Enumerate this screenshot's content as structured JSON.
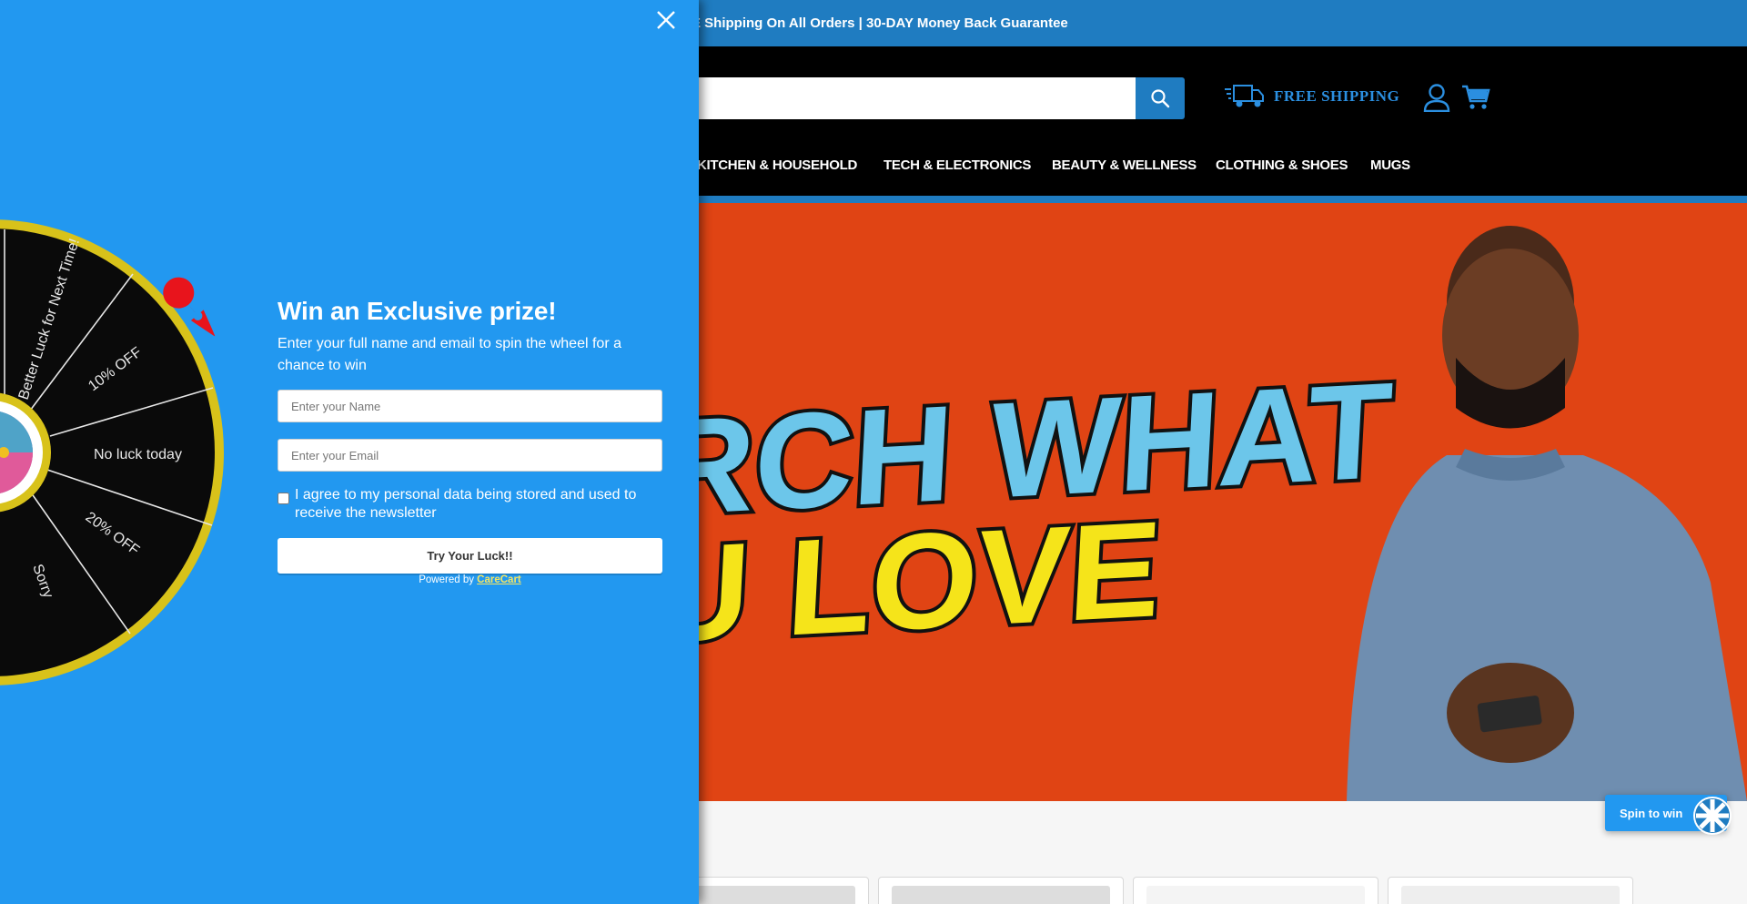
{
  "announcement": {
    "text": "E Shipping On All Orders | 30-DAY Money Back Guarantee"
  },
  "header": {
    "search_placeholder": "",
    "free_shipping_label": "FREE SHIPPING",
    "nav": [
      "KITCHEN & HOUSEHOLD",
      "TECH & ELECTRONICS",
      "BEAUTY & WELLNESS",
      "CLOTHING & SHOES",
      "MUGS"
    ]
  },
  "hero": {
    "line1": "RCH WHAT",
    "line2": "U LOVE"
  },
  "spin_widget": {
    "label": "Spin to win"
  },
  "popup": {
    "title": "Win an Exclusive prize!",
    "description": "Enter your full name and email to spin the wheel for a chance to win",
    "name_placeholder": "Enter your Name",
    "email_placeholder": "Enter your Email",
    "consent_label": "I agree to my personal data being stored and used to receive the newsletter",
    "button_label": "Try Your Luck!!",
    "powered_by_prefix": "Powered by",
    "powered_by_link": "CareCart",
    "wheel_segments": [
      "Better Luck for Next Time!",
      "10% OFF",
      "No luck today",
      "20% OFF",
      "Sorry"
    ]
  },
  "colors": {
    "popup_bg": "#2298f0",
    "brand_blue": "#1f7cc1",
    "hero_bg": "#e04414",
    "wheel_rim": "#d8c21a",
    "pointer": "#e8141c",
    "powered_link": "#f5e663"
  },
  "icons": [
    "close-icon",
    "search-icon",
    "truck-icon",
    "account-icon",
    "cart-icon",
    "pointer-icon",
    "mini-wheel-icon"
  ]
}
